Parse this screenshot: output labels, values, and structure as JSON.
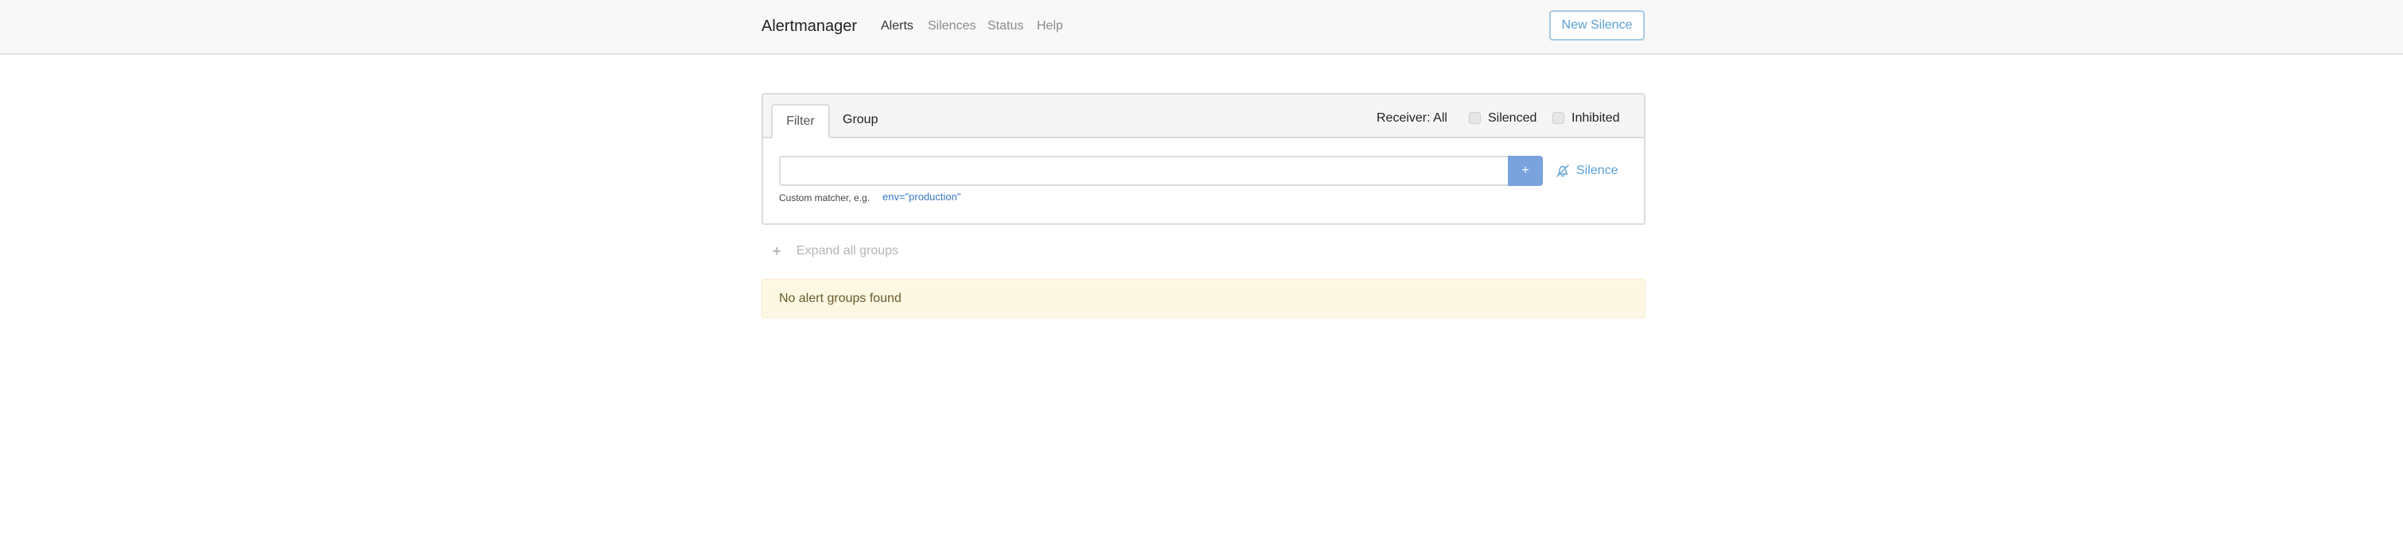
{
  "navbar": {
    "brand": "Alertmanager",
    "links": [
      {
        "label": "Alerts",
        "active": true
      },
      {
        "label": "Silences",
        "active": false
      },
      {
        "label": "Status",
        "active": false
      },
      {
        "label": "Help",
        "active": false
      }
    ],
    "new_silence_label": "New Silence"
  },
  "filter_panel": {
    "tabs": [
      {
        "label": "Filter",
        "active": true
      },
      {
        "label": "Group",
        "active": false
      }
    ],
    "receiver_label": "Receiver: All",
    "silenced_label": "Silenced",
    "silenced_checked": false,
    "inhibited_label": "Inhibited",
    "inhibited_checked": false,
    "input_value": "",
    "add_button_label": "+",
    "silence_link_label": "Silence",
    "silence_icon": "bell-slash-icon",
    "hint_text": "Custom matcher, e.g.",
    "hint_example": "env=\"production\""
  },
  "groups": {
    "expand_icon": "plus-icon",
    "expand_label": "Expand all groups",
    "empty_message": "No alert groups found"
  },
  "colors": {
    "navbar_bg": "#f8f8f8",
    "accent": "#5aa0d6",
    "add_button_bg": "#7aa3de",
    "warning_bg": "#fcf8e3"
  }
}
